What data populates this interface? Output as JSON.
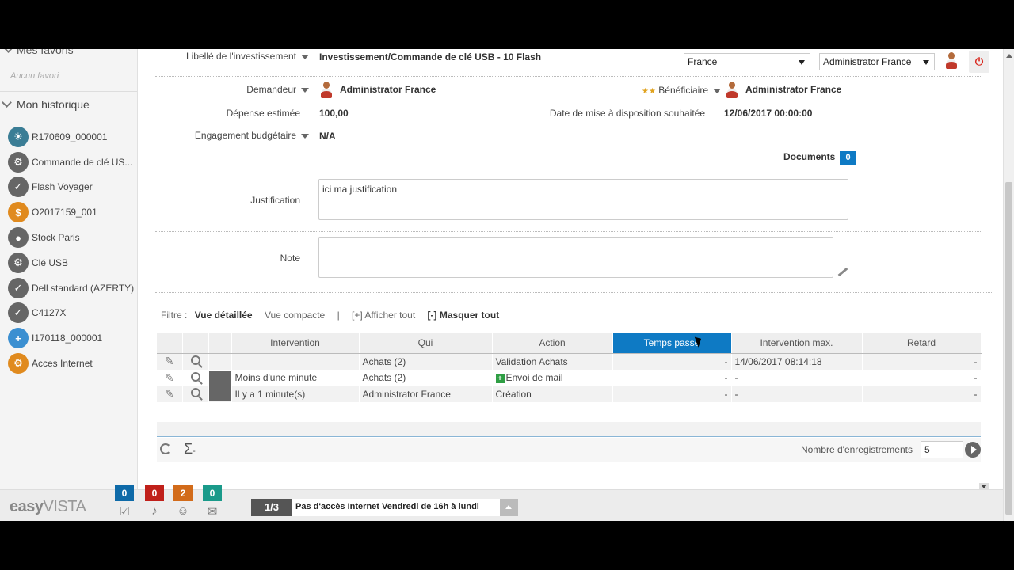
{
  "sidebar": {
    "favorites_title": "Mes favoris",
    "no_favorites": "Aucun favori",
    "history_title": "Mon historique",
    "items": [
      {
        "label": "R170609_000001",
        "icon": "lightbulb-icon",
        "color": "#3a7d95"
      },
      {
        "label": "Commande de clé US...",
        "icon": "document-gear-icon",
        "color": "#666666"
      },
      {
        "label": "Flash Voyager",
        "icon": "document-check-icon",
        "color": "#666666"
      },
      {
        "label": "O2017159_001",
        "icon": "document-money-icon",
        "color": "#e08a1e"
      },
      {
        "label": "Stock Paris",
        "icon": "location-pin-icon",
        "color": "#666666"
      },
      {
        "label": "Clé USB",
        "icon": "gear-check-icon",
        "color": "#666666"
      },
      {
        "label": "Dell standard (AZERTY)",
        "icon": "document-check-icon",
        "color": "#666666"
      },
      {
        "label": "C4127X",
        "icon": "document-check-icon",
        "color": "#666666"
      },
      {
        "label": "I170118_000001",
        "icon": "first-aid-icon",
        "color": "#3b8fd1"
      },
      {
        "label": "Acces Internet",
        "icon": "gear-icon",
        "color": "#e08a1e"
      }
    ]
  },
  "header": {
    "country_select": "France",
    "user_select": "Administrator France"
  },
  "form": {
    "libelle_label": "Libellé de l'investissement",
    "libelle_value": "Investissement/Commande de clé USB - 10 Flash",
    "demandeur_label": "Demandeur",
    "demandeur_value": "Administrator France",
    "beneficiaire_label": "Bénéficiaire",
    "beneficiaire_value": "Administrator France",
    "depense_label": "Dépense estimée",
    "depense_value": "100,00",
    "date_label": "Date de mise à disposition souhaitée",
    "date_value": "12/06/2017 00:00:00",
    "engagement_label": "Engagement budgétaire",
    "engagement_value": "N/A",
    "documents_label": "Documents",
    "documents_count": "0",
    "justification_label": "Justification",
    "justification_value": "ici ma justification",
    "note_label": "Note",
    "note_value": ""
  },
  "filter": {
    "label": "Filtre :",
    "detailed": "Vue détaillée",
    "compact": "Vue compacte",
    "separator": "|",
    "show_all": "[+] Afficher tout",
    "hide_all": "[-] Masquer tout"
  },
  "grid": {
    "headers": [
      "Intervention",
      "Qui",
      "Action",
      "Temps passé",
      "Intervention max.",
      "Retard"
    ],
    "active_header": "Temps passé",
    "rows": [
      {
        "intervention": "",
        "qui": "Achats (2)",
        "action": "Validation Achats",
        "temps": "-",
        "max": "14/06/2017 08:14:18",
        "retard": "-",
        "action_icon": false
      },
      {
        "intervention": "Moins d'une minute",
        "qui": "Achats (2)",
        "action": "Envoi de mail",
        "temps": "-",
        "max": "-",
        "retard": "-",
        "action_icon": true
      },
      {
        "intervention": "Il y a 1 minute(s)",
        "qui": "Administrator France",
        "action": "Création",
        "temps": "-",
        "max": "-",
        "retard": "-",
        "action_icon": false
      }
    ],
    "footer_sigma": "-",
    "records_label": "Nombre d'enregistrements",
    "records_value": "5"
  },
  "bottombar": {
    "logo_easy": "easy",
    "logo_vista": "VISTA",
    "counters": [
      {
        "value": "0",
        "color": "#0e6aa8",
        "icon": "checklist-icon"
      },
      {
        "value": "0",
        "color": "#c0201a",
        "icon": "alert-bell-icon"
      },
      {
        "value": "2",
        "color": "#d26b1a",
        "icon": "group-icon"
      },
      {
        "value": "0",
        "color": "#1a9a8a",
        "icon": "chat-icon"
      }
    ],
    "news_index": "1/3",
    "news_text": "Pas d'accès Internet Vendredi de 16h à lundi"
  },
  "colors": {
    "accent": "#0e7ac4",
    "logout": "#d9261c"
  }
}
